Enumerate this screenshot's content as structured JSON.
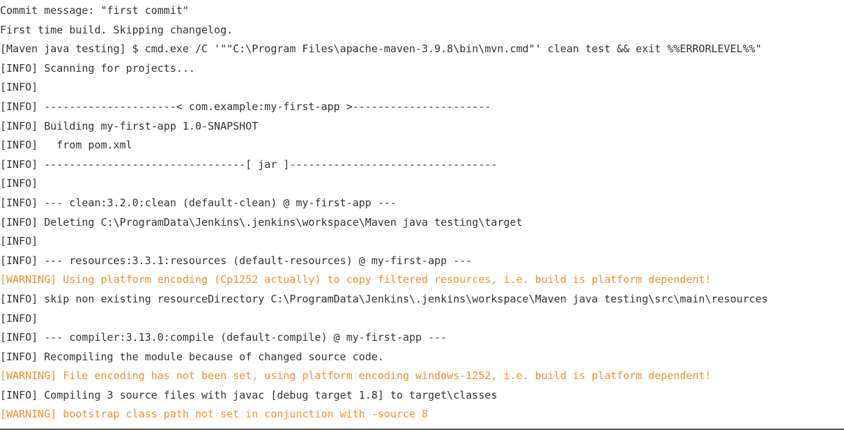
{
  "console": {
    "lines": [
      {
        "text": "Commit message: \"first commit\"",
        "level": "plain"
      },
      {
        "text": "First time build. Skipping changelog.",
        "level": "plain"
      },
      {
        "text": "[Maven java testing] $ cmd.exe /C '\"\"C:\\Program Files\\apache-maven-3.9.8\\bin\\mvn.cmd\"' clean test && exit %%ERRORLEVEL%%\"",
        "level": "plain"
      },
      {
        "text": "[INFO] Scanning for projects...",
        "level": "info"
      },
      {
        "text": "[INFO]",
        "level": "info"
      },
      {
        "text": "[INFO] ---------------------< com.example:my-first-app >----------------------",
        "level": "info"
      },
      {
        "text": "[INFO] Building my-first-app 1.0-SNAPSHOT",
        "level": "info"
      },
      {
        "text": "[INFO]   from pom.xml",
        "level": "info"
      },
      {
        "text": "[INFO] --------------------------------[ jar ]---------------------------------",
        "level": "info"
      },
      {
        "text": "[INFO]",
        "level": "info"
      },
      {
        "text": "[INFO] --- clean:3.2.0:clean (default-clean) @ my-first-app ---",
        "level": "info"
      },
      {
        "text": "[INFO] Deleting C:\\ProgramData\\Jenkins\\.jenkins\\workspace\\Maven java testing\\target",
        "level": "info"
      },
      {
        "text": "[INFO]",
        "level": "info"
      },
      {
        "text": "[INFO] --- resources:3.3.1:resources (default-resources) @ my-first-app ---",
        "level": "info"
      },
      {
        "text": "[WARNING] Using platform encoding (Cp1252 actually) to copy filtered resources, i.e. build is platform dependent!",
        "level": "warning"
      },
      {
        "text": "[INFO] skip non existing resourceDirectory C:\\ProgramData\\Jenkins\\.jenkins\\workspace\\Maven java testing\\src\\main\\resources",
        "level": "info"
      },
      {
        "text": "[INFO]",
        "level": "info"
      },
      {
        "text": "[INFO] --- compiler:3.13.0:compile (default-compile) @ my-first-app ---",
        "level": "info"
      },
      {
        "text": "[INFO] Recompiling the module because of changed source code.",
        "level": "info"
      },
      {
        "text": "[WARNING] File encoding has not been set, using platform encoding windows-1252, i.e. build is platform dependent!",
        "level": "warning"
      },
      {
        "text": "[INFO] Compiling 3 source files with javac [debug target 1.8] to target\\classes",
        "level": "info"
      },
      {
        "text": "[WARNING] bootstrap class path not set in conjunction with -source 8",
        "level": "warning"
      }
    ]
  },
  "colors": {
    "text": "#333333",
    "warning": "#f0902a",
    "background": "#ffffff"
  }
}
